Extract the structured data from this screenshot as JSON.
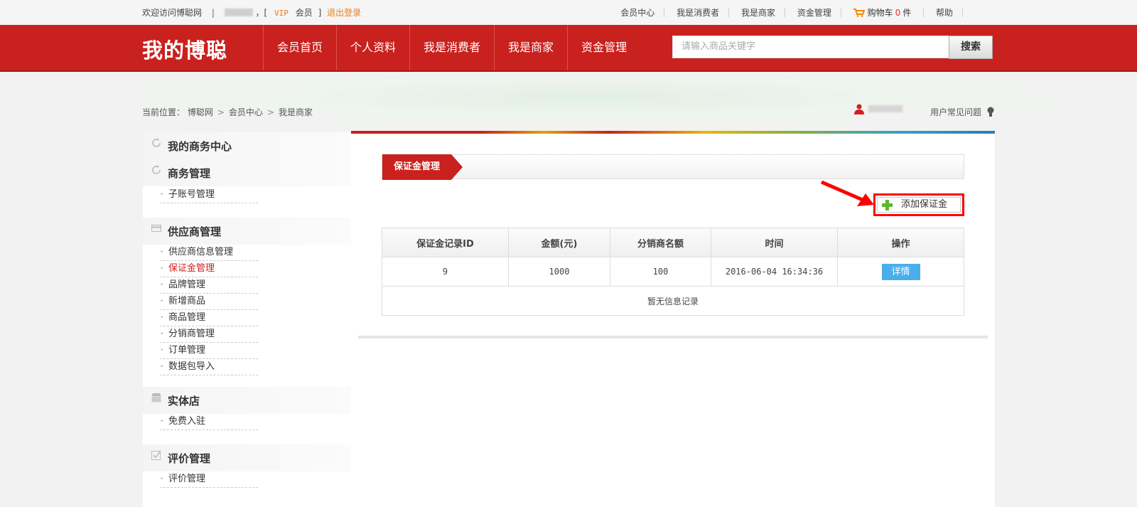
{
  "topbar": {
    "welcome": "欢迎访问博聪网",
    "bracket_open": "，[",
    "vip": "VIP",
    "member": "会员",
    "bracket_close": "]",
    "logout": "退出登录",
    "links": [
      "会员中心",
      "我是消费者",
      "我是商家",
      "资金管理"
    ],
    "cart_label": "购物车",
    "cart_count": "0",
    "cart_unit": "件",
    "help": "帮助"
  },
  "header": {
    "logo": "我的博聪",
    "nav": [
      "会员首页",
      "个人资料",
      "我是消费者",
      "我是商家",
      "资金管理"
    ],
    "search_placeholder": "请输入商品关键字",
    "search_button": "搜索"
  },
  "breadcrumb": {
    "prefix": "当前位置：",
    "items": [
      "博聪网",
      "会员中心",
      "我是商家"
    ]
  },
  "userbar": {
    "faq": "用户常见问题"
  },
  "sidebar": {
    "sections": [
      {
        "title": "我的商务中心",
        "icon": "refresh-icon"
      },
      {
        "title": "商务管理",
        "icon": "refresh-icon",
        "items": [
          "子账号管理"
        ]
      },
      {
        "title": "供应商管理",
        "icon": "card-icon",
        "items": [
          "供应商信息管理",
          "保证金管理",
          "品牌管理",
          "新增商品",
          "商品管理",
          "分销商管理",
          "订单管理",
          "数据包导入"
        ]
      },
      {
        "title": "实体店",
        "icon": "store-icon",
        "items": [
          "免费入驻"
        ]
      },
      {
        "title": "评价管理",
        "icon": "checkbox-icon",
        "items": [
          "评价管理"
        ]
      }
    ],
    "active_item": "保证金管理"
  },
  "main": {
    "tab": "保证金管理",
    "add_button": "添加保证金",
    "table": {
      "headers": [
        "保证金记录ID",
        "金额(元)",
        "分销商名额",
        "时间",
        "操作"
      ],
      "rows": [
        {
          "id": "9",
          "amount": "1000",
          "quota": "100",
          "time": "2016-06-04 16:34:36",
          "action": "详情"
        }
      ],
      "empty_text": "暂无信息记录"
    }
  },
  "colors": {
    "brand_red": "#c9211e",
    "link_orange": "#e67e22",
    "detail_blue": "#4aaeea",
    "highlight_red": "#ff0000"
  }
}
